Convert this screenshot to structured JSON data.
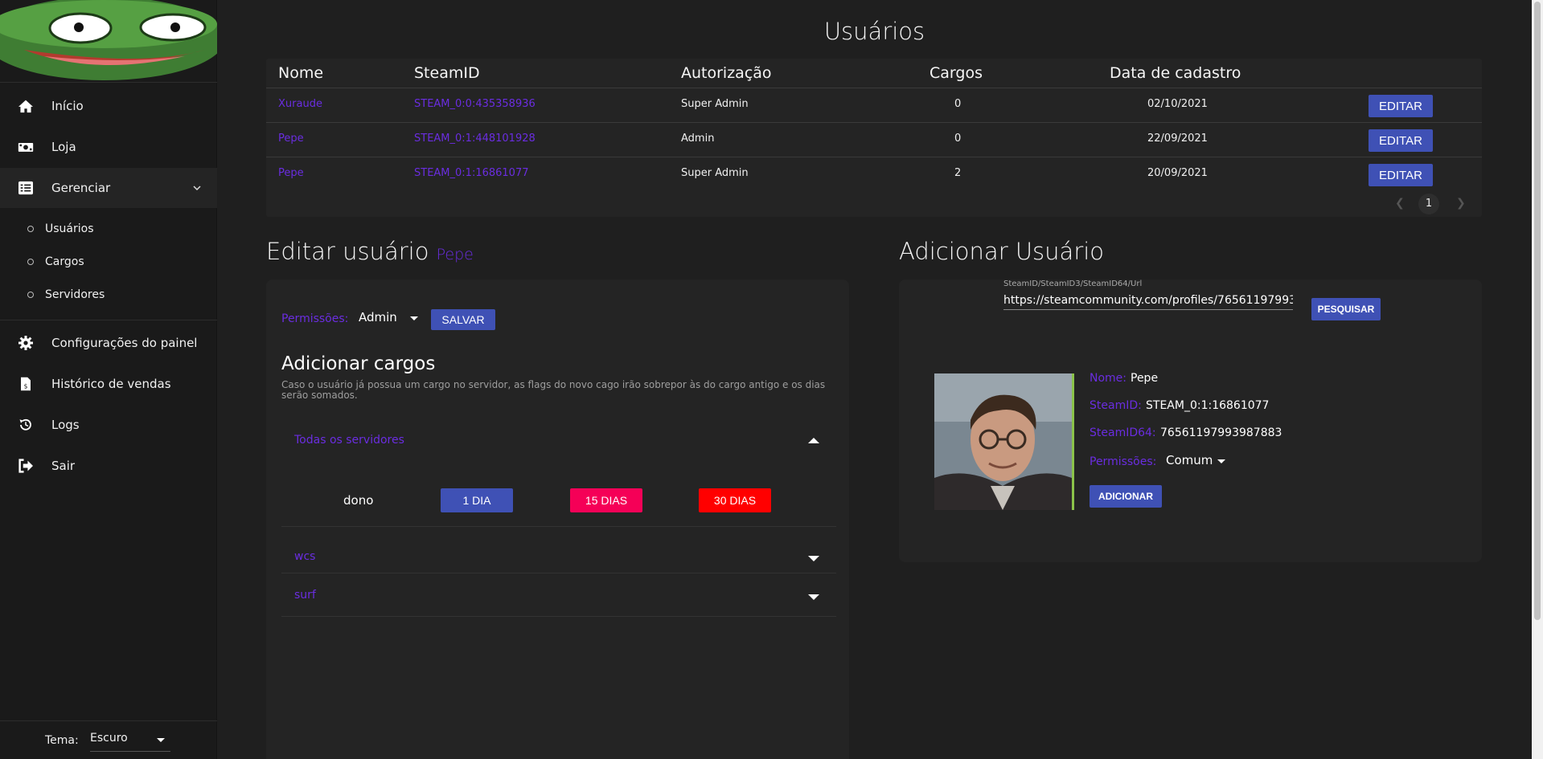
{
  "sidebar": {
    "items": [
      {
        "label": "Início",
        "icon": "home-icon"
      },
      {
        "label": "Loja",
        "icon": "money-icon"
      },
      {
        "label": "Gerenciar",
        "icon": "list-icon"
      }
    ],
    "sub_items": [
      {
        "label": "Usuários"
      },
      {
        "label": "Cargos"
      },
      {
        "label": "Servidores"
      }
    ],
    "items_bottom": [
      {
        "label": "Configurações do painel",
        "icon": "gear-icon"
      },
      {
        "label": "Histórico de vendas",
        "icon": "receipt-icon"
      },
      {
        "label": "Logs",
        "icon": "history-icon"
      },
      {
        "label": "Sair",
        "icon": "logout-icon"
      }
    ],
    "theme_label": "Tema:",
    "theme_value": "Escuro"
  },
  "users": {
    "title": "Usuários",
    "columns": [
      "Nome",
      "SteamID",
      "Autorização",
      "Cargos",
      "Data de cadastro"
    ],
    "rows": [
      {
        "name": "Xuraude",
        "steamid": "STEAM_0:0:435358936",
        "auth": "Super Admin",
        "roles": "0",
        "date": "02/10/2021"
      },
      {
        "name": "Pepe",
        "steamid": "STEAM_0:1:448101928",
        "auth": "Admin",
        "roles": "0",
        "date": "22/09/2021"
      },
      {
        "name": "Pepe",
        "steamid": "STEAM_0:1:16861077",
        "auth": "Super Admin",
        "roles": "2",
        "date": "20/09/2021"
      }
    ],
    "edit_label": "EDITAR",
    "page": "1"
  },
  "edit": {
    "title": "Editar usuário",
    "user": "Pepe",
    "perm_label": "Permissões:",
    "perm_value": "Admin",
    "save_label": "SALVAR",
    "add_roles_title": "Adicionar cargos",
    "desc": "Caso o usuário já possua um cargo no servidor, as flags do novo cago irão sobrepor às do cargo antigo e os dias serão somados.",
    "servers": [
      {
        "name": "Todas os servidores",
        "expanded": true
      },
      {
        "name": "wcs",
        "expanded": false
      },
      {
        "name": "surf",
        "expanded": false
      }
    ],
    "role": "dono",
    "durations": [
      {
        "label": "1 DIA",
        "color": "#3f51b5"
      },
      {
        "label": "15 DIAS",
        "color": "#f50057"
      },
      {
        "label": "30 DIAS",
        "color": "#ff0000"
      }
    ]
  },
  "add": {
    "title": "Adicionar Usuário",
    "search_label": "SteamID/SteamID3/SteamID64/Url",
    "search_value": "https://steamcommunity.com/profiles/76561197993",
    "search_btn": "PESQUISAR",
    "name_label": "Nome:",
    "name_value": "Pepe",
    "steamid_label": "SteamID:",
    "steamid_value": "STEAM_0:1:16861077",
    "steamid64_label": "SteamID64:",
    "steamid64_value": "76561197993987883",
    "perm_label": "Permissões:",
    "perm_value": "Comum",
    "add_btn": "ADICIONAR"
  },
  "colors": {
    "accent": "#6a2de0",
    "button": "#3f51b5",
    "pink": "#f50057",
    "red": "#ff0000"
  }
}
